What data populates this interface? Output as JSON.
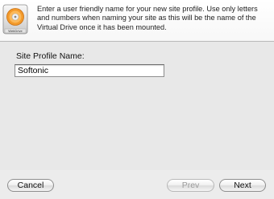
{
  "header": {
    "app_icon_name": "webdrive-icon",
    "app_icon_text": "WebDrive",
    "instructions": "Enter a user friendly name for your new site profile. Use only letters and numbers when naming your site as this will be the name of the Virtual Drive once it has been mounted."
  },
  "form": {
    "site_profile_label": "Site Profile Name:",
    "site_profile_value": "Softonic"
  },
  "footer": {
    "cancel_label": "Cancel",
    "prev_label": "Prev",
    "next_label": "Next"
  },
  "colors": {
    "window_bg": "#ececec",
    "header_bg": "#ffffff",
    "disabled_text": "#9a9a9a"
  }
}
